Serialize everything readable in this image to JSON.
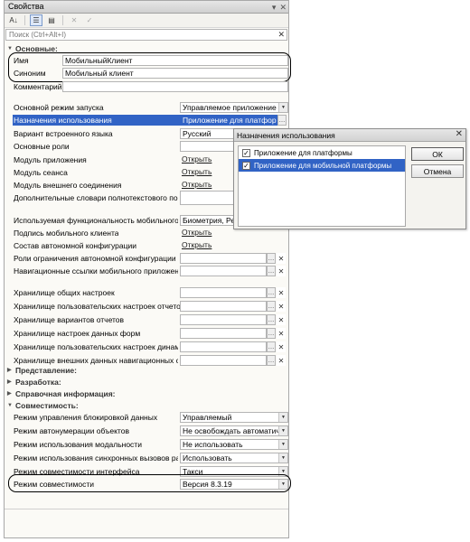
{
  "panel": {
    "title": "Свойства",
    "search_placeholder": "Поиск (Ctrl+Alt+I)"
  },
  "sections": {
    "main": "Основные:",
    "presentation": "Представление:",
    "development": "Разработка:",
    "reference": "Справочная информация:",
    "compatibility": "Совместимость:"
  },
  "main": {
    "name_label": "Имя",
    "name_value": "МобильныйКлиент",
    "synonym_label": "Синоним",
    "synonym_value": "Мобильный клиент",
    "comment_label": "Комментарий",
    "launch_mode_label": "Основной режим запуска",
    "launch_mode_value": "Управляемое приложение",
    "usage_label": "Назначения использования",
    "usage_value": "Приложение для платформы",
    "language_label": "Вариант встроенного языка",
    "language_value": "Русский",
    "roles_label": "Основные роли",
    "app_module_label": "Модуль приложения",
    "session_module_label": "Модуль сеанса",
    "ext_conn_module_label": "Модуль внешнего соединения",
    "dict_label": "Дополнительные словари полнотекстового поиск",
    "mobile_func_label": "Используемая функциональность мобильного пр",
    "mobile_func_value": "Биометрия, Рез",
    "sign_label": "Подпись мобильного клиента",
    "offline_label": "Состав автономной конфигурации",
    "roles_offline_label": "Роли ограничения автономной конфигурации",
    "nav_links_label": "Навигационные ссылки мобильного приложения",
    "open_link": "Открыть"
  },
  "storage": {
    "common": "Хранилище общих настроек",
    "report_user": "Хранилище пользовательских настроек отчетов",
    "report_variants": "Хранилище вариантов отчетов",
    "form_data": "Хранилище настроек данных форм",
    "dynamic_user": "Хранилище пользовательских настроек динамич",
    "nav_external": "Хранилище внешних данных навигационных ссыл"
  },
  "compat": {
    "lock_label": "Режим управления блокировкой данных",
    "lock_value": "Управляемый",
    "autonum_label": "Режим автонумерации объектов",
    "autonum_value": "Не освобождать автоматиче",
    "modal_label": "Режим использования модальности",
    "modal_value": "Не использовать",
    "sync_label": "Режим использования синхронных вызовов расш",
    "sync_value": "Использовать",
    "iface_label": "Режим совместимости интерфейса",
    "iface_value": "Такси",
    "compat_label": "Режим совместимости",
    "compat_value": "Версия 8.3.19"
  },
  "dialog": {
    "title": "Назначения использования",
    "items": [
      {
        "label": "Приложение для платформы",
        "checked": true,
        "selected": false
      },
      {
        "label": "Приложение для мобильной платформы",
        "checked": true,
        "selected": true
      }
    ],
    "ok_label": "ОК",
    "cancel_label": "Отмена"
  },
  "icons": {
    "sort_alpha": "sort-az-icon",
    "categorize": "categorize-icon",
    "toggle": "filter-icon",
    "clear": "close-icon",
    "apply": "check-icon"
  }
}
